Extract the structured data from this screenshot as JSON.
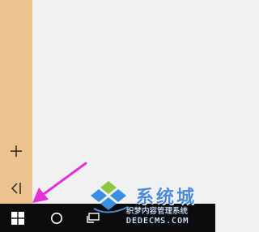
{
  "colors": {
    "rail": "#ecc38f",
    "content": "#f1f1f1",
    "taskbar": "#0c0c0c",
    "arrow": "#e52fd9",
    "watermark_blue": "#4a8ad6",
    "watermark_green": "#8dc63f"
  },
  "start_rail": {
    "add_icon": "plus-icon",
    "collapse_icon": "collapse-left-icon"
  },
  "taskbar": {
    "start_icon": "windows-logo-icon",
    "search_icon": "cortana-circle-icon",
    "taskview_icon": "task-view-icon"
  },
  "watermark": {
    "brand": "系统城",
    "sub1": "织梦内容管理系统",
    "sub2": "DEDECMS.COM"
  }
}
